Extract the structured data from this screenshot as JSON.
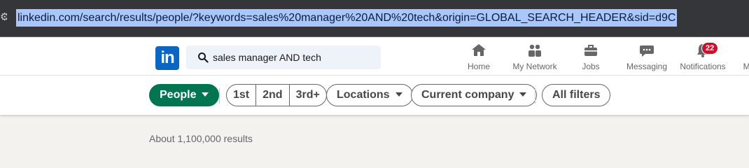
{
  "browser": {
    "url": "linkedin.com/search/results/people/?keywords=sales%20manager%20AND%20tech&origin=GLOBAL_SEARCH_HEADER&sid=d9C"
  },
  "nav": {
    "logo": "in",
    "search_value": "sales manager AND tech",
    "items": [
      {
        "label": "Home",
        "icon": "home-icon"
      },
      {
        "label": "My Network",
        "icon": "network-icon"
      },
      {
        "label": "Jobs",
        "icon": "briefcase-icon"
      },
      {
        "label": "Messaging",
        "icon": "chat-icon"
      },
      {
        "label": "Notifications",
        "icon": "bell-icon",
        "badge": "22"
      },
      {
        "label": "Me",
        "icon": "avatar-icon"
      }
    ]
  },
  "filters": {
    "people": "People",
    "connections": [
      "1st",
      "2nd",
      "3rd+"
    ],
    "locations": "Locations",
    "current_company": "Current company",
    "all_filters": "All filters"
  },
  "results_text": "About 1,100,000 results",
  "colors": {
    "linkedin_blue": "#0a66c2",
    "active_green": "#01754f",
    "badge_red": "#cb112d"
  }
}
